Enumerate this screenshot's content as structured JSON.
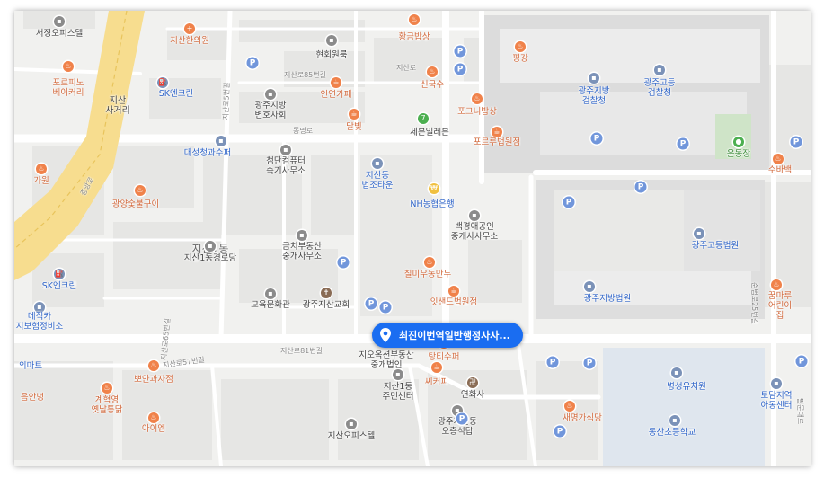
{
  "colors": {
    "bank": "#f0c040",
    "water": "#dfe6ee",
    "block": "#e4e4e2",
    "callout": "#1a6df1"
  },
  "selected_place": {
    "name": "최진이번역일반행정사사..."
  },
  "areas": [
    {
      "id": "jisan1dong",
      "name": "지산1동"
    },
    {
      "id": "jisan-crossroad",
      "name": "지산\n사거리"
    }
  ],
  "roads": [
    {
      "id": "jisanro85",
      "name": "지산로85번길"
    },
    {
      "id": "jisanro57",
      "name": "지산로57번길"
    },
    {
      "id": "dongmyeongro",
      "name": "동명로"
    },
    {
      "id": "jisanro",
      "name": "지산로"
    },
    {
      "id": "jungangro",
      "name": "중앙로"
    },
    {
      "id": "jisanro81",
      "name": "지산로81번길"
    },
    {
      "id": "jisanro65",
      "name": "지산로65번길"
    },
    {
      "id": "jisanro5",
      "name": "지산로5번길"
    },
    {
      "id": "jungboro",
      "name": "준법로25번길"
    },
    {
      "id": "pilmunro",
      "name": "필문대로"
    }
  ],
  "places": [
    {
      "id": "seojeong",
      "name": "서정오피스텔",
      "color": "gray"
    },
    {
      "id": "jisanhan",
      "name": "지산한의원",
      "color": "orange"
    },
    {
      "id": "hwanggeum",
      "name": "황금밥상",
      "color": "orange"
    },
    {
      "id": "hyeonhoe",
      "name": "현회원룸",
      "color": "gray"
    },
    {
      "id": "pyeongchang",
      "name": "평강",
      "color": "orange"
    },
    {
      "id": "portofino",
      "name": "포르피노\n베이커리",
      "color": "orange"
    },
    {
      "id": "sk1",
      "name": "SK엔크린",
      "color": "blue"
    },
    {
      "id": "gwangjujibang-byeon",
      "name": "광주지방\n변호사회",
      "color": "gray"
    },
    {
      "id": "ingyeon",
      "name": "인연카페",
      "color": "orange"
    },
    {
      "id": "singuksu",
      "name": "신국수",
      "color": "orange"
    },
    {
      "id": "pogeunibapsang",
      "name": "포그니밥상",
      "color": "orange"
    },
    {
      "id": "gwangju-geomchal",
      "name": "광주지방\n검찰청",
      "color": "blue"
    },
    {
      "id": "gwangju-godeung-geomchal",
      "name": "광주고등\n검찰청",
      "color": "blue"
    },
    {
      "id": "dalbit",
      "name": "달빛",
      "color": "orange"
    },
    {
      "id": "seven",
      "name": "세븐일레븐",
      "color": "green"
    },
    {
      "id": "forum",
      "name": "포르루법원점",
      "color": "orange"
    },
    {
      "id": "undongjang",
      "name": "운동장",
      "color": "green"
    },
    {
      "id": "daeseong",
      "name": "대성청과수퍼",
      "color": "blue"
    },
    {
      "id": "cheomdan",
      "name": "첨단컴퓨터\n속기사무소",
      "color": "gray"
    },
    {
      "id": "garden",
      "name": "가원",
      "color": "orange"
    },
    {
      "id": "jisandong-law",
      "name": "지산동\n법조타운",
      "color": "blue"
    },
    {
      "id": "nh",
      "name": "NH농협은행",
      "color": "bank"
    },
    {
      "id": "subaek",
      "name": "수바백",
      "color": "orange"
    },
    {
      "id": "gwangyang",
      "name": "광양숯불구이",
      "color": "orange"
    },
    {
      "id": "baekgyeong",
      "name": "백경애공인\n중개사사무소",
      "color": "gray"
    },
    {
      "id": "jisan1-police",
      "name": "지산1동경로당",
      "color": "gray"
    },
    {
      "id": "geumchi",
      "name": "금치부동산\n중개사무소",
      "color": "gray"
    },
    {
      "id": "gwangju-godeung-court",
      "name": "광주고등법원",
      "color": "blue"
    },
    {
      "id": "chilmi",
      "name": "칠미우동만두",
      "color": "orange"
    },
    {
      "id": "sk2",
      "name": "SK엔크린",
      "color": "blue"
    },
    {
      "id": "isaend",
      "name": "잇샌드법원점",
      "color": "orange"
    },
    {
      "id": "gyoyuk",
      "name": "교육문화관",
      "color": "gray"
    },
    {
      "id": "gwangju-jisan-church",
      "name": "광주지산교회",
      "color": "brown"
    },
    {
      "id": "gwangju-jibang-court",
      "name": "광주지방법원",
      "color": "blue"
    },
    {
      "id": "kkummaru",
      "name": "꿈마루\n어린이집",
      "color": "orange"
    },
    {
      "id": "medicar",
      "name": "메직카\n지보험정비소",
      "color": "blue"
    },
    {
      "id": "jiok",
      "name": "지오옥션부동산\n중개법인",
      "color": "gray"
    },
    {
      "id": "tang",
      "name": "탕티수퍼",
      "color": "orange"
    },
    {
      "id": "ppeonyang",
      "name": "뽀얀과자점",
      "color": "orange"
    },
    {
      "id": "essemart",
      "name": "의마트",
      "color": "blue"
    },
    {
      "id": "jisan1-center",
      "name": "지산1동\n주민센터",
      "color": "gray"
    },
    {
      "id": "ssicafe",
      "name": "씨커피",
      "color": "orange"
    },
    {
      "id": "yeonhwa",
      "name": "연화사",
      "color": "brown"
    },
    {
      "id": "byeongseong",
      "name": "병성유치원",
      "color": "blue"
    },
    {
      "id": "todam",
      "name": "토담지역\n아동센터",
      "color": "blue"
    },
    {
      "id": "gyehyeok",
      "name": "계혁영\n옛날통닭",
      "color": "orange"
    },
    {
      "id": "eumanyeong",
      "name": "음안녕",
      "color": "orange"
    },
    {
      "id": "saemyeong",
      "name": "새명가식당",
      "color": "orange"
    },
    {
      "id": "gwangju-jisan-ochon",
      "name": "광주지산동\n오층석탑",
      "color": "gray"
    },
    {
      "id": "dongsan",
      "name": "동산초등학교",
      "color": "blue"
    },
    {
      "id": "aiyeom",
      "name": "아이엠",
      "color": "orange"
    },
    {
      "id": "jisan-office",
      "name": "지산오피스텔",
      "color": "gray"
    }
  ]
}
